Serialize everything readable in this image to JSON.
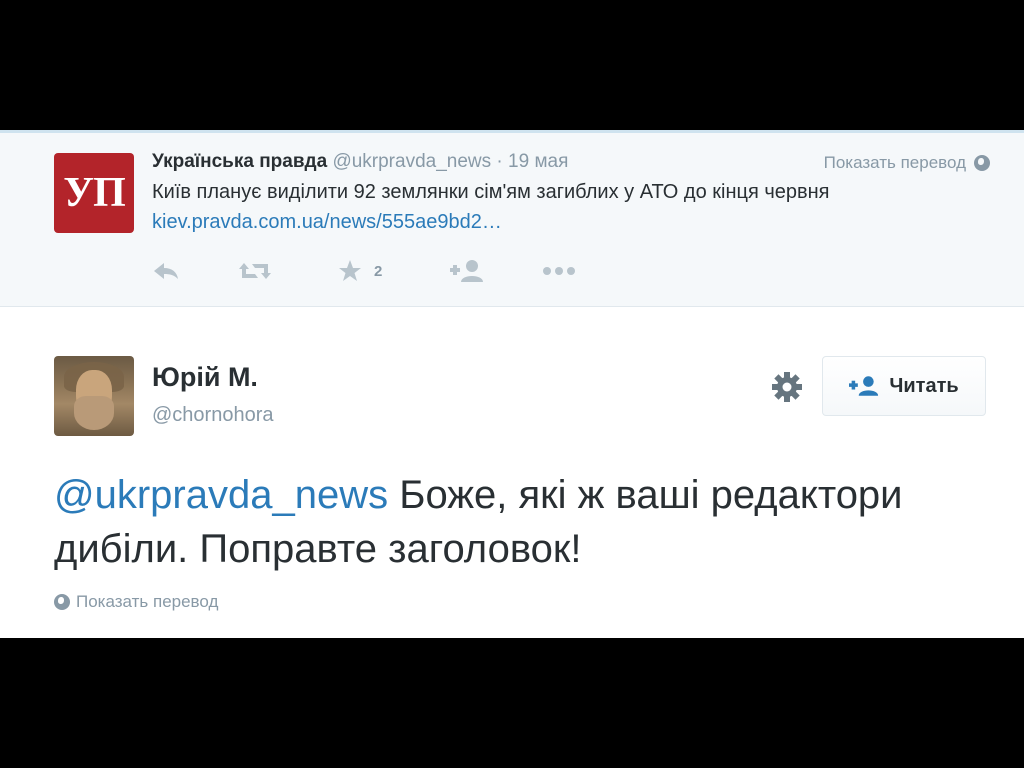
{
  "quoted_tweet": {
    "logo_text": "УП",
    "name": "Українська правда",
    "handle": "@ukrpravda_news",
    "separator": "·",
    "date": "19 мая",
    "translate_label": "Показать перевод",
    "text": "Київ планує виділити 92 землянки сім'ям загиблих у АТО до кінця червня",
    "link": "kiev.pravda.com.ua/news/555ae9bd2…",
    "favorite_count": "2",
    "actions": [
      "reply-icon",
      "retweet-icon",
      "favorite-icon",
      "follow-icon",
      "more-icon"
    ]
  },
  "tweet": {
    "author_name": "Юрій М.",
    "author_handle": "@chornohora",
    "follow_label": "Читать",
    "mention": "@ukrpravda_news",
    "text_after_mention": " Боже, які ж ваші редактори дибіли. Поправте заголовок!",
    "translate_label": "Показать перевод"
  },
  "colors": {
    "link": "#2b7bb9",
    "muted": "#8899a6",
    "text": "#292f33",
    "logo_red": "#b3242a",
    "quoted_bg": "#f5f8fa"
  }
}
